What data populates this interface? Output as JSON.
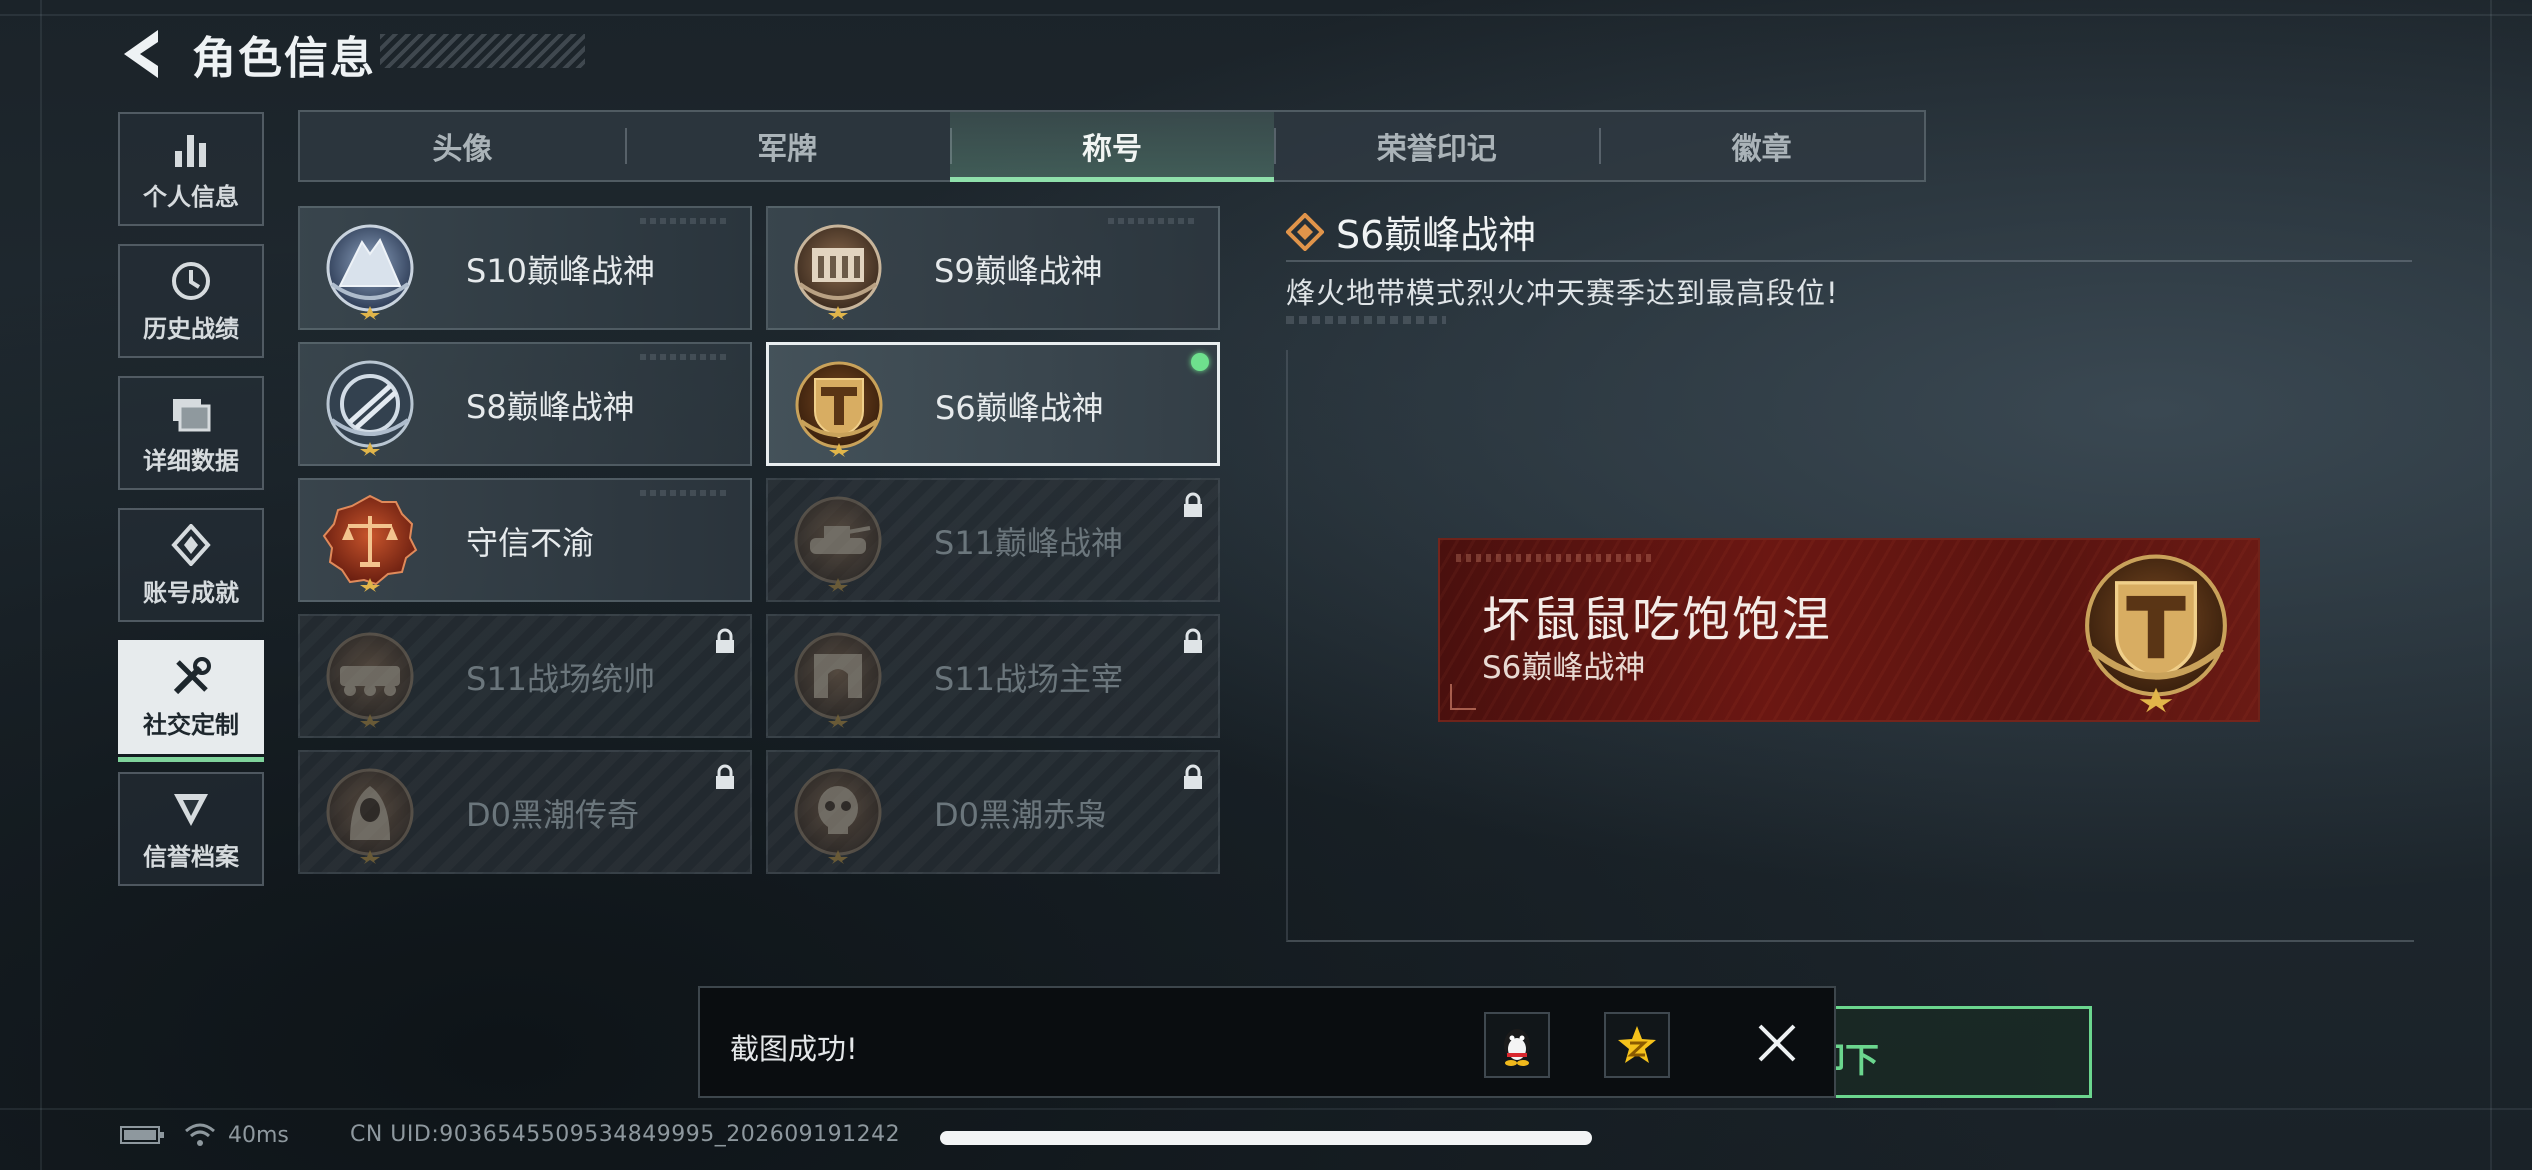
{
  "header": {
    "title": "角色信息",
    "back_icon": "back-arrow-icon"
  },
  "sidenav": {
    "items": [
      {
        "label": "个人信息",
        "icon": "bar-chart-icon",
        "active": false
      },
      {
        "label": "历史战绩",
        "icon": "history-clock-icon",
        "active": false
      },
      {
        "label": "详细数据",
        "icon": "folder-data-icon",
        "active": false
      },
      {
        "label": "账号成就",
        "icon": "achievement-icon",
        "active": false
      },
      {
        "label": "社交定制",
        "icon": "wrench-screwdriver-icon",
        "active": true
      },
      {
        "label": "信誉档案",
        "icon": "credit-shield-icon",
        "active": false
      }
    ]
  },
  "tabs": {
    "items": [
      {
        "label": "头像",
        "active": false
      },
      {
        "label": "军牌",
        "active": false
      },
      {
        "label": "称号",
        "active": true
      },
      {
        "label": "荣誉印记",
        "active": false
      },
      {
        "label": "徽章",
        "active": false
      }
    ]
  },
  "titles": [
    {
      "name": "S10巅峰战神",
      "locked": false,
      "selected": false,
      "emblem": "mountain-emblem-icon"
    },
    {
      "name": "S9巅峰战神",
      "locked": false,
      "selected": false,
      "emblem": "ruins-emblem-icon"
    },
    {
      "name": "S8巅峰战神",
      "locked": false,
      "selected": false,
      "emblem": "crossed-rifles-emblem-icon"
    },
    {
      "name": "S6巅峰战神",
      "locked": false,
      "selected": true,
      "equipped": true,
      "emblem": "t-shield-emblem-icon"
    },
    {
      "name": "守信不渝",
      "locked": false,
      "selected": false,
      "emblem": "scales-emblem-icon"
    },
    {
      "name": "S11巅峰战神",
      "locked": true,
      "selected": false,
      "emblem": "tank-emblem-icon"
    },
    {
      "name": "S11战场统帅",
      "locked": true,
      "selected": false,
      "emblem": "apc-emblem-icon"
    },
    {
      "name": "S11战场主宰",
      "locked": true,
      "selected": false,
      "emblem": "arch-emblem-icon"
    },
    {
      "name": "D0黑潮传奇",
      "locked": true,
      "selected": false,
      "emblem": "hooded-figure-emblem-icon"
    },
    {
      "name": "D0黑潮赤枭",
      "locked": true,
      "selected": false,
      "emblem": "skull-emblem-icon"
    }
  ],
  "detail": {
    "title": "S6巅峰战神",
    "description": "烽火地带模式烈火冲天赛季达到最高段位!"
  },
  "banner": {
    "player_name": "坏鼠鼠吃饱饱涅",
    "title": "S6巅峰战神"
  },
  "unequip_button": {
    "label": "卸下"
  },
  "toast": {
    "message": "截图成功!",
    "share_qq_icon": "qq-penguin-icon",
    "share_qzone_icon": "qzone-star-icon",
    "close_icon": "close-icon"
  },
  "status_bar": {
    "ping": "40ms",
    "uid": "CN UID:9036545509534849995_202609191242"
  },
  "colors": {
    "accent_green": "#6bd68e",
    "banner_red": "#6b1712",
    "emblem_gold": "#c9a25a"
  }
}
